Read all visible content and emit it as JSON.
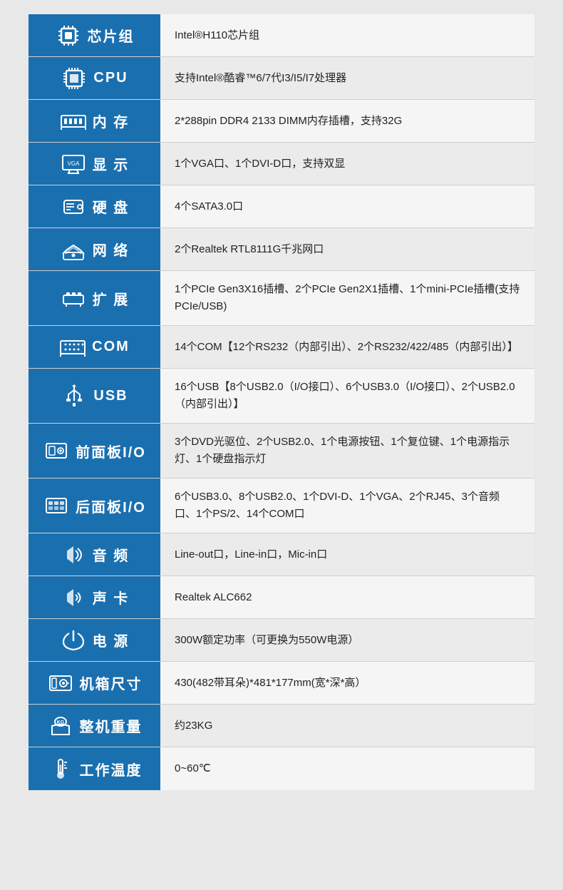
{
  "rows": [
    {
      "id": "chipset",
      "label": "芯片组",
      "icon": "chipset",
      "value": "Intel®H110芯片组"
    },
    {
      "id": "cpu",
      "label": "CPU",
      "icon": "cpu",
      "value": "支持Intel®酷睿™6/7代I3/I5/I7处理器"
    },
    {
      "id": "memory",
      "label": "内 存",
      "icon": "memory",
      "value": "2*288pin DDR4 2133 DIMM内存插槽，支持32G"
    },
    {
      "id": "display",
      "label": "显 示",
      "icon": "display",
      "value": "1个VGA口、1个DVI-D口，支持双显"
    },
    {
      "id": "harddisk",
      "label": "硬 盘",
      "icon": "harddisk",
      "value": "4个SATA3.0口"
    },
    {
      "id": "network",
      "label": "网 络",
      "icon": "network",
      "value": "2个Realtek RTL8111G千兆网口"
    },
    {
      "id": "expansion",
      "label": "扩 展",
      "icon": "expansion",
      "value": "1个PCIe Gen3X16插槽、2个PCIe Gen2X1插槽、1个mini-PCIe插槽(支持PCIe/USB)"
    },
    {
      "id": "com",
      "label": "COM",
      "icon": "com",
      "value": "14个COM【12个RS232（内部引出）、2个RS232/422/485（内部引出）】"
    },
    {
      "id": "usb",
      "label": "USB",
      "icon": "usb",
      "value": "16个USB【8个USB2.0（I/O接口）、6个USB3.0（I/O接口）、2个USB2.0（内部引出）】"
    },
    {
      "id": "front-panel",
      "label": "前面板I/O",
      "icon": "frontpanel",
      "value": "3个DVD光驱位、2个USB2.0、1个电源按钮、1个复位键、1个电源指示灯、1个硬盘指示灯"
    },
    {
      "id": "rear-panel",
      "label": "后面板I/O",
      "icon": "rearpanel",
      "value": "6个USB3.0、8个USB2.0、1个DVI-D、1个VGA、2个RJ45、3个音频口、1个PS/2、14个COM口"
    },
    {
      "id": "audio",
      "label": "音 频",
      "icon": "audio",
      "value": "Line-out口，Line-in口，Mic-in口"
    },
    {
      "id": "soundcard",
      "label": "声 卡",
      "icon": "soundcard",
      "value": "Realtek ALC662"
    },
    {
      "id": "power",
      "label": "电 源",
      "icon": "power",
      "value": "300W额定功率（可更换为550W电源）"
    },
    {
      "id": "chassis",
      "label": "机箱尺寸",
      "icon": "chassis",
      "value": "430(482带耳朵)*481*177mm(宽*深*高）"
    },
    {
      "id": "weight",
      "label": "整机重量",
      "icon": "weight",
      "value": "约23KG"
    },
    {
      "id": "temperature",
      "label": "工作温度",
      "icon": "temperature",
      "value": "0~60℃"
    }
  ]
}
